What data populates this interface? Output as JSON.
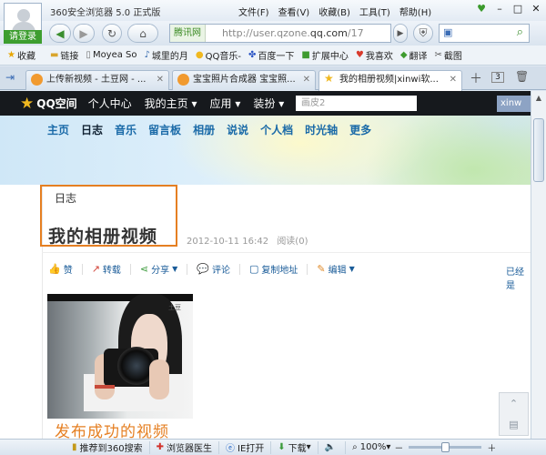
{
  "browser": {
    "title": "360安全浏览器 5.0 正式版",
    "login_label": "请登录",
    "menu": [
      "文件(F)",
      "查看(V)",
      "收藏(B)",
      "工具(T)",
      "帮助(H)"
    ],
    "address_brand": "腾讯网",
    "address_url_prefix": "http://user.qzone.",
    "address_url_domain": "qq.com",
    "address_url_suffix": "/17",
    "favorites": [
      {
        "label": "收藏",
        "icon": "star-icon"
      },
      {
        "label": "链接",
        "icon": "folder-icon"
      },
      {
        "label": "Moyea So",
        "icon": "page-icon"
      },
      {
        "label": "城里的月",
        "icon": "music-icon"
      },
      {
        "label": "QQ音乐-",
        "icon": "qq-icon"
      },
      {
        "label": "百度一下",
        "icon": "paw-icon"
      },
      {
        "label": "扩展中心",
        "icon": "cube-icon"
      },
      {
        "label": "我喜欢",
        "icon": "heart-icon"
      },
      {
        "label": "翻译",
        "icon": "translate-icon"
      },
      {
        "label": "截图",
        "icon": "scissors-icon"
      }
    ],
    "tabs": [
      {
        "label": "上传新视频 - 土豆网 - ...",
        "active": false
      },
      {
        "label": "宝宝照片合成器 宝宝照...",
        "active": false
      },
      {
        "label": "我的相册视频|xinwi软...",
        "active": true
      }
    ],
    "tab_count": "3"
  },
  "qzone": {
    "logo": "QQ空间",
    "nav": [
      "个人中心",
      "我的主页",
      "应用",
      "装扮"
    ],
    "search_placeholder": "画皮2",
    "user": "xinw",
    "blog_nav": [
      "主页",
      "日志",
      "音乐",
      "留言板",
      "相册",
      "说说",
      "个人档",
      "时光轴",
      "更多"
    ],
    "blog_nav_active": "日志"
  },
  "post": {
    "category": "日志",
    "title": "我的相册视频",
    "date": "2012-10-11 16:42",
    "reads": "阅读(0)",
    "actions": [
      "赞",
      "转载",
      "分享",
      "评论",
      "复制地址",
      "编辑"
    ],
    "already": "已经是",
    "photo_tag": "土豆",
    "caption": "发布成功的视频"
  },
  "status": {
    "items": [
      "推荐到360搜索",
      "浏览器医生",
      "IE打开",
      "下载"
    ],
    "zoom": "100%",
    "zoom_level": 0.5
  }
}
